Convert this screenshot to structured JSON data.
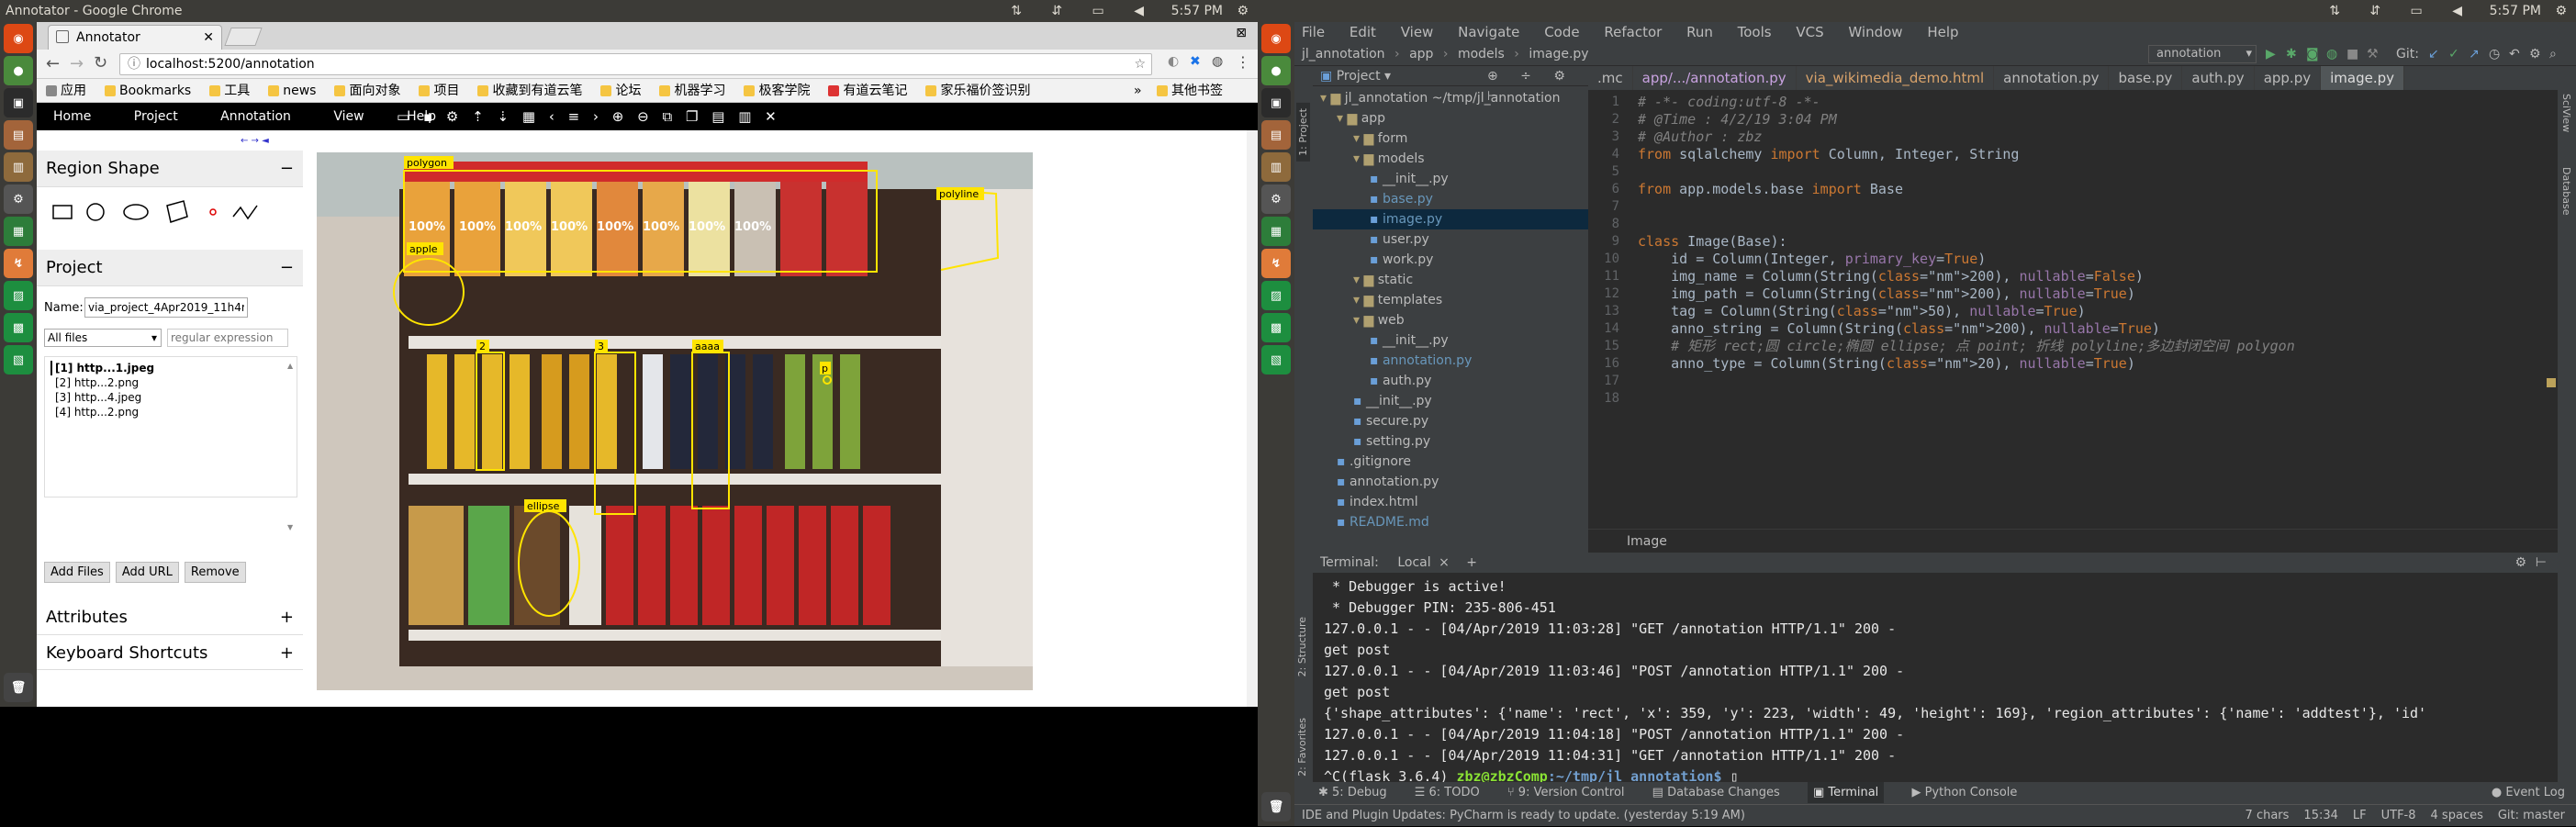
{
  "left_screen": {
    "os_title": "Annotator - Google Chrome",
    "clock": "5:57 PM",
    "tab_title": "Annotator",
    "url": "localhost:5200/annotation",
    "bookmarks": [
      "应用",
      "Bookmarks",
      "工具",
      "news",
      "面向对象",
      "项目",
      "收藏到有道云笔",
      "论坛",
      "机器学习",
      "极客学院",
      "有道云笔记",
      "家乐福价签识别"
    ],
    "bookmark_more": "»",
    "other_bookmarks": "其他书签",
    "nav": [
      "Home",
      "Project",
      "Annotation",
      "View",
      "Help"
    ],
    "region_shape_title": "Region Shape",
    "project_title": "Project",
    "name_label": "Name:",
    "project_name": "via_project_4Apr2019_11h4m",
    "files_filter": "All files",
    "regex_placeholder": "regular expression",
    "files": [
      "[1] http...1.jpeg",
      "[2] http...2.png",
      "[3] http...4.jpeg",
      "[4] http...2.png"
    ],
    "buttons": [
      "Add Files",
      "Add URL",
      "Remove"
    ],
    "attributes_title": "Attributes",
    "shortcuts_title": "Keyboard Shortcuts",
    "plus": "+",
    "minus": "−",
    "image_labels": [
      "polygon",
      "apple",
      "polyline",
      "2",
      "3",
      "aaaa",
      "p",
      "ellipse"
    ],
    "brand": "100%"
  },
  "right_screen": {
    "clock": "5:57 PM",
    "menu": [
      "File",
      "Edit",
      "View",
      "Navigate",
      "Code",
      "Refactor",
      "Run",
      "Tools",
      "VCS",
      "Window",
      "Help"
    ],
    "breadcrumb": [
      "jl_annotation",
      "app",
      "models",
      "image.py"
    ],
    "run_config": "annotation",
    "git_label": "Git:",
    "project_label": "Project",
    "editor_tabs": [
      ".mc",
      "app/.../annotation.py",
      "via_wikimedia_demo.html",
      "annotation.py",
      "base.py",
      "auth.py",
      "app.py",
      "image.py"
    ],
    "tree": [
      {
        "t": "jl_annotation ~/tmp/jl_annotation",
        "d": 0,
        "c": "folder"
      },
      {
        "t": "app",
        "d": 1,
        "c": "folder"
      },
      {
        "t": "form",
        "d": 2,
        "c": "folder"
      },
      {
        "t": "models",
        "d": 2,
        "c": "folder"
      },
      {
        "t": "__init__.py",
        "d": 3,
        "c": "py"
      },
      {
        "t": "base.py",
        "d": 3,
        "c": "pyb"
      },
      {
        "t": "image.py",
        "d": 3,
        "c": "pyb"
      },
      {
        "t": "user.py",
        "d": 3,
        "c": "py"
      },
      {
        "t": "work.py",
        "d": 3,
        "c": "py"
      },
      {
        "t": "static",
        "d": 2,
        "c": "folder"
      },
      {
        "t": "templates",
        "d": 2,
        "c": "folder"
      },
      {
        "t": "web",
        "d": 2,
        "c": "folder"
      },
      {
        "t": "__init__.py",
        "d": 3,
        "c": "py"
      },
      {
        "t": "annotation.py",
        "d": 3,
        "c": "pyb"
      },
      {
        "t": "auth.py",
        "d": 3,
        "c": "py"
      },
      {
        "t": "__init__.py",
        "d": 2,
        "c": "py"
      },
      {
        "t": "secure.py",
        "d": 2,
        "c": "py"
      },
      {
        "t": "setting.py",
        "d": 2,
        "c": "py"
      },
      {
        "t": ".gitignore",
        "d": 1,
        "c": "py"
      },
      {
        "t": "annotation.py",
        "d": 1,
        "c": "py"
      },
      {
        "t": "index.html",
        "d": 1,
        "c": "py"
      },
      {
        "t": "README.md",
        "d": 1,
        "c": "pyb"
      }
    ],
    "code": [
      "# -*- coding:utf-8 -*-",
      "# @Time : 4/2/19 3:04 PM",
      "# @Author : zbz",
      "from sqlalchemy import Column, Integer, String",
      "",
      "from app.models.base import Base",
      "",
      "",
      "class Image(Base):",
      "    id = Column(Integer, primary_key=True)",
      "    img_name = Column(String(200), nullable=False)",
      "    img_path = Column(String(200), nullable=True)",
      "    tag = Column(String(50), nullable=True)",
      "    anno_string = Column(String(200), nullable=True)",
      "    # 矩形 rect;圆 circle;椭圆 ellipse; 点 point; 折线 polyline;多边封闭空间 polygon",
      "    anno_type = Column(String(20), nullable=True)",
      "",
      ""
    ],
    "editor_crumb": "Image",
    "terminal_label": "Terminal:",
    "terminal_tab": "Local",
    "terminal": [
      " * Debugger is active!",
      " * Debugger PIN: 235-806-451",
      "127.0.0.1 - - [04/Apr/2019 11:03:28] \"GET /annotation HTTP/1.1\" 200 -",
      "get post",
      "127.0.0.1 - - [04/Apr/2019 11:03:46] \"POST /annotation HTTP/1.1\" 200 -",
      "get post",
      "{'shape_attributes': {'name': 'rect', 'x': 359, 'y': 223, 'width': 49, 'height': 169}, 'region_attributes': {'name': 'addtest'}, 'id'",
      "127.0.0.1 - - [04/Apr/2019 11:04:18] \"POST /annotation HTTP/1.1\" 200 -",
      "127.0.0.1 - - [04/Apr/2019 11:04:31] \"GET /annotation HTTP/1.1\" 200 -"
    ],
    "prompt_env": "^C(flask_3.6.4) ",
    "prompt_user": "zbz@zbzComp",
    "prompt_path": ":~/tmp/jl_annotation$",
    "bottom_tabs": [
      "5: Debug",
      "6: TODO",
      "9: Version Control",
      "Database Changes",
      "Terminal",
      "Python Console"
    ],
    "event_log": "Event Log",
    "status_msg": "IDE and Plugin Updates: PyCharm is ready to update. (yesterday 5:19 AM)",
    "status_right": [
      "7 chars",
      "15:34",
      "LF",
      "UTF-8",
      "4 spaces",
      "Git: master"
    ],
    "side_labels": [
      "1: Project",
      "2: Structure",
      "2: Favorites",
      "SciView",
      "Database"
    ]
  }
}
